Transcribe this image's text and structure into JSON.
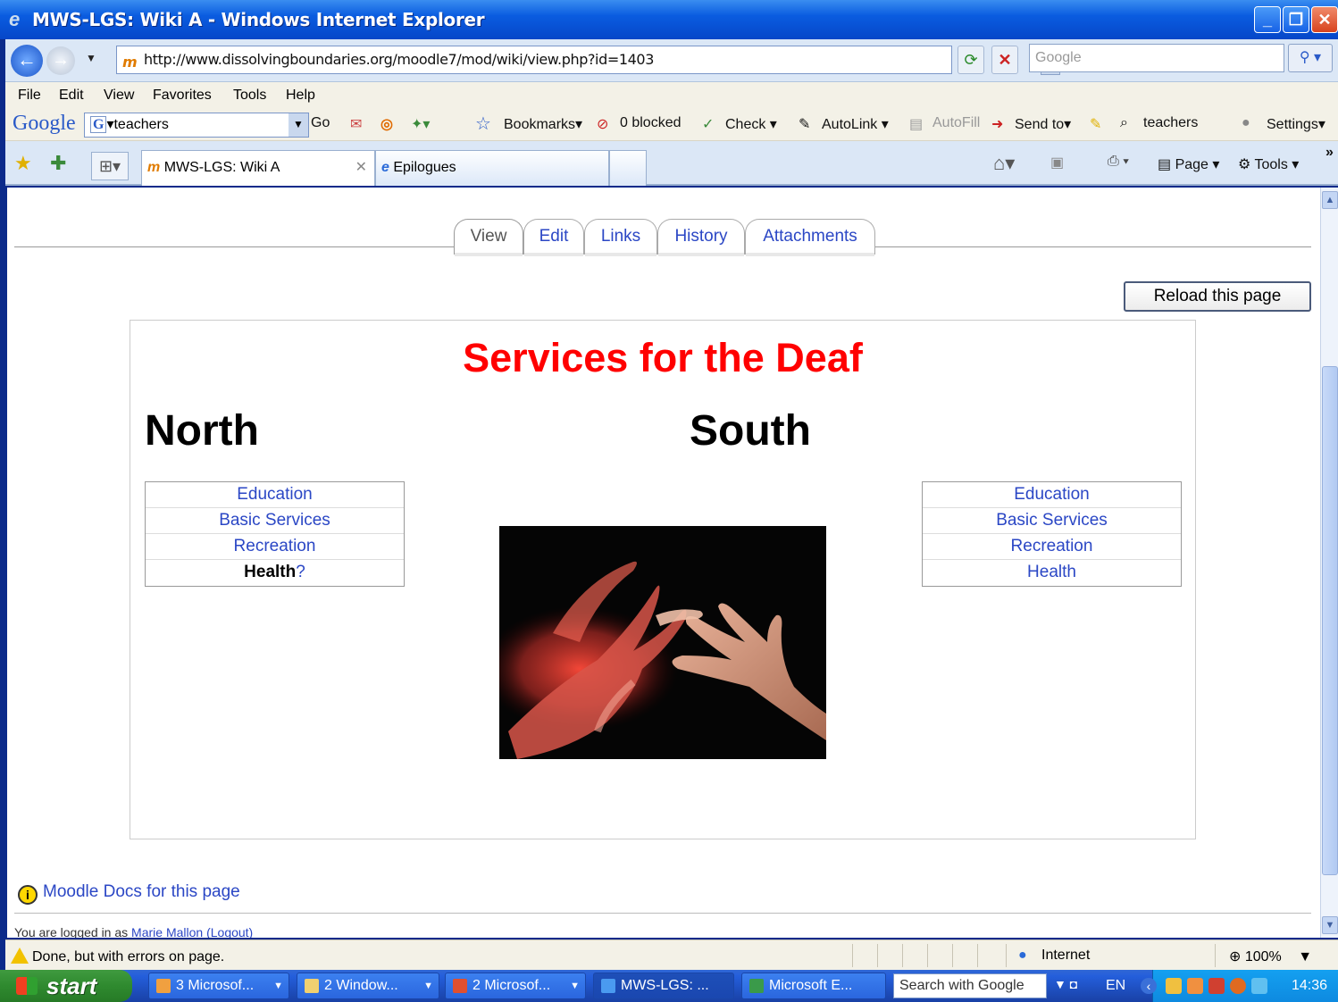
{
  "window": {
    "title": "MWS-LGS: Wiki A - Windows Internet Explorer",
    "url": "http://www.dissolvingboundaries.org/moodle7/mod/wiki/view.php?id=1403",
    "search_placeholder": "Google"
  },
  "menu": [
    "File",
    "Edit",
    "View",
    "Favorites",
    "Tools",
    "Help"
  ],
  "google_toolbar": {
    "logo": "Google",
    "query": "teachers",
    "go": "Go",
    "bookmarks": "Bookmarks",
    "blocked": "0 blocked",
    "check": "Check",
    "autolink": "AutoLink",
    "autofill": "AutoFill",
    "send_to": "Send to",
    "teachers": "teachers",
    "settings": "Settings"
  },
  "browser_tabs": [
    {
      "label": "MWS-LGS: Wiki A",
      "active": true
    },
    {
      "label": "Epilogues",
      "active": false
    }
  ],
  "command_bar": {
    "page": "Page",
    "tools": "Tools"
  },
  "wiki_tabs": [
    "View",
    "Edit",
    "Links",
    "History",
    "Attachments"
  ],
  "reload_label": "Reload this page",
  "page": {
    "title": "Services for the Deaf",
    "north": {
      "heading": "North",
      "links": [
        "Education",
        "Basic Services",
        "Recreation",
        "Health"
      ],
      "missing_marker": "?"
    },
    "south": {
      "heading": "South",
      "links": [
        "Education",
        "Basic Services",
        "Recreation",
        "Health"
      ]
    }
  },
  "footer": {
    "docs_link": "Moodle Docs for this page",
    "logged_in_prefix": "You are logged in as",
    "user": "Marie Mallon",
    "logout": "(Logout)"
  },
  "status": {
    "message": "Done, but with errors on page.",
    "zone": "Internet",
    "zoom": "100%"
  },
  "taskbar": {
    "start": "start",
    "buttons": [
      "3 Microsof...",
      "2 Window...",
      "2 Microsof...",
      "MWS-LGS: ...",
      "Microsoft E..."
    ],
    "search": "Search with Google",
    "lang": "EN",
    "clock": "14:36"
  }
}
